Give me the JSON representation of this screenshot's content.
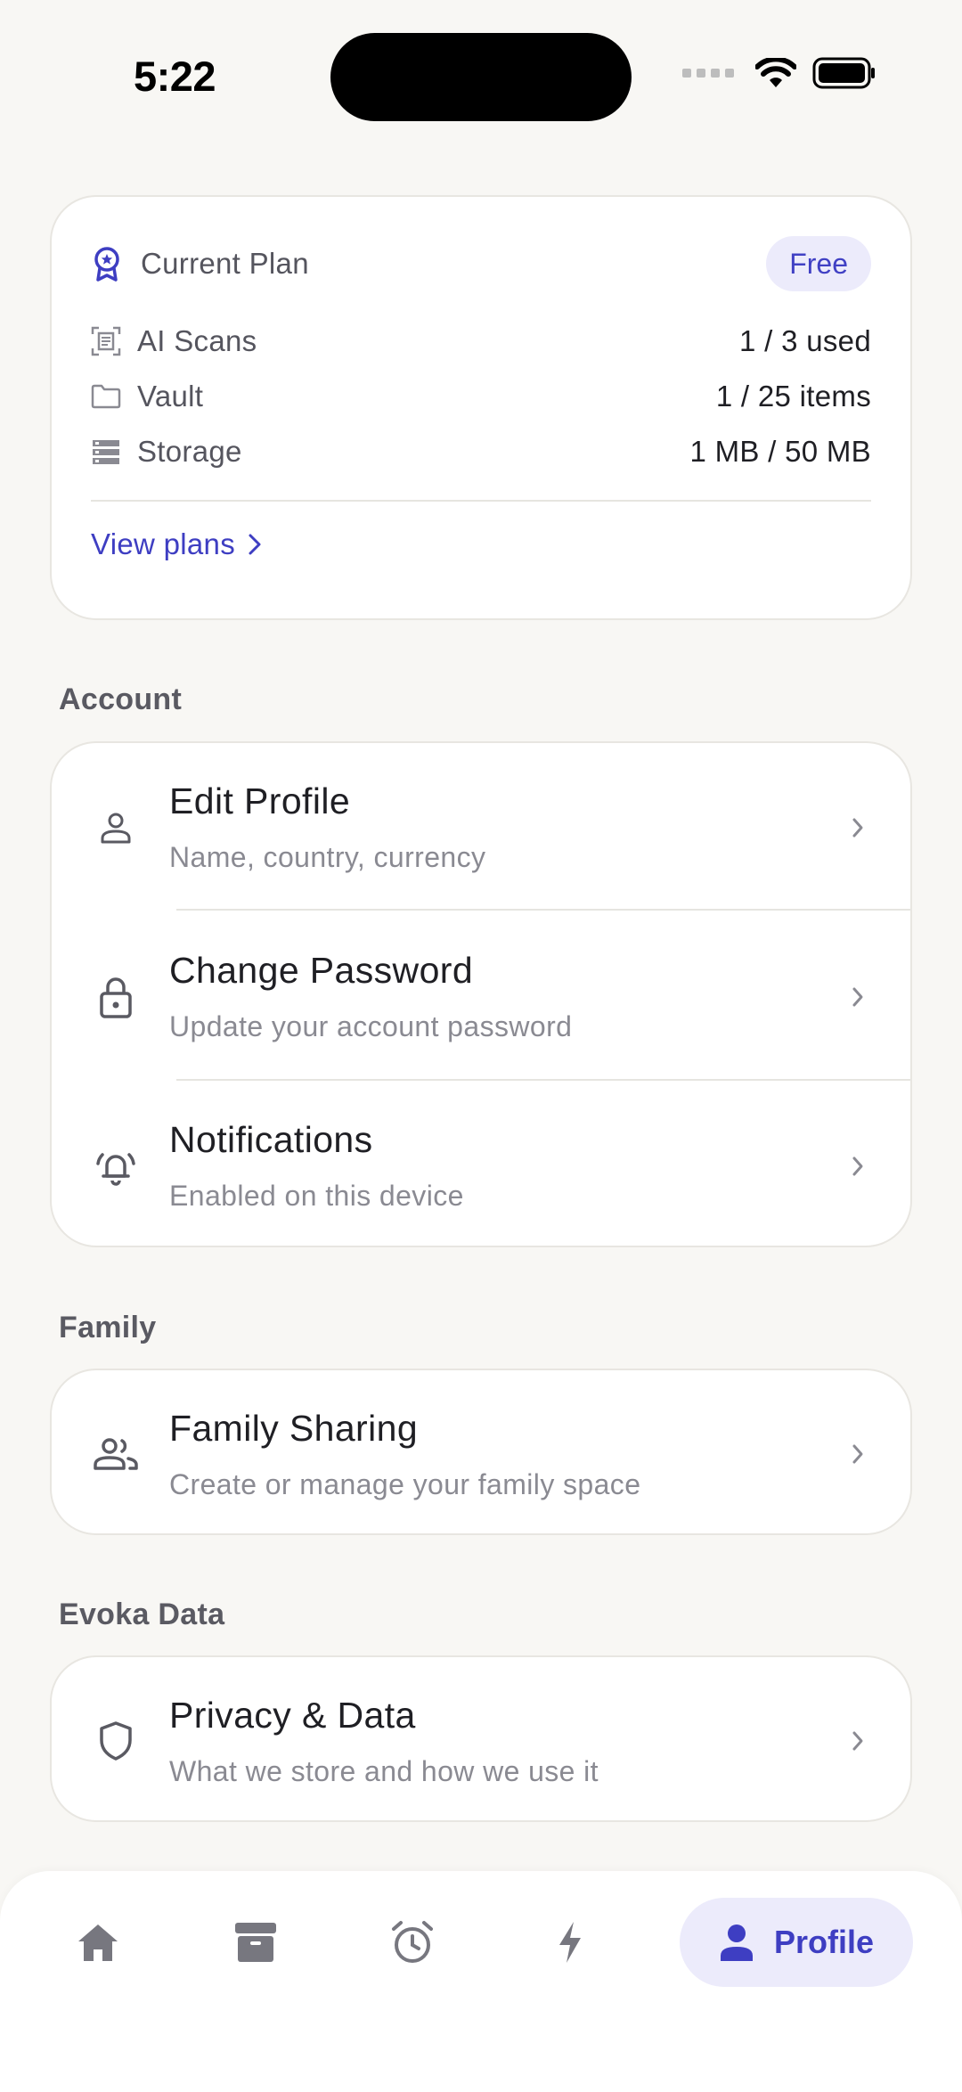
{
  "status_bar": {
    "time": "5:22"
  },
  "plan_card": {
    "label": "Current Plan",
    "badge": "Free",
    "usage": [
      {
        "name": "AI Scans",
        "value": "1 / 3 used",
        "icon": "scan-icon"
      },
      {
        "name": "Vault",
        "value": "1 / 25 items",
        "icon": "folder-icon"
      },
      {
        "name": "Storage",
        "value": "1 MB / 50 MB",
        "icon": "storage-icon"
      }
    ],
    "link": "View plans"
  },
  "account": {
    "title": "Account",
    "items": [
      {
        "title": "Edit Profile",
        "subtitle": "Name, country, currency",
        "icon": "person-icon"
      },
      {
        "title": "Change Password",
        "subtitle": "Update your account password",
        "icon": "lock-icon"
      },
      {
        "title": "Notifications",
        "subtitle": "Enabled on this device",
        "icon": "bell-icon"
      }
    ]
  },
  "family": {
    "title": "Family",
    "items": [
      {
        "title": "Family Sharing",
        "subtitle": "Create or manage your family space",
        "icon": "people-icon"
      }
    ]
  },
  "evoka_data": {
    "title": "Evoka Data",
    "items": [
      {
        "title": "Privacy & Data",
        "subtitle": "What we store and how we use it",
        "icon": "shield-icon"
      }
    ]
  },
  "tab_bar": {
    "tabs": [
      {
        "icon": "home-icon"
      },
      {
        "icon": "archive-icon"
      },
      {
        "icon": "alarm-icon"
      },
      {
        "icon": "bolt-icon"
      },
      {
        "icon": "profile-icon",
        "label": "Profile",
        "active": true
      }
    ]
  },
  "colors": {
    "accent": "#3e3ec2",
    "accent_bg": "#ecebfb",
    "background": "#f8f7f4",
    "muted_text": "#8a8a92"
  }
}
